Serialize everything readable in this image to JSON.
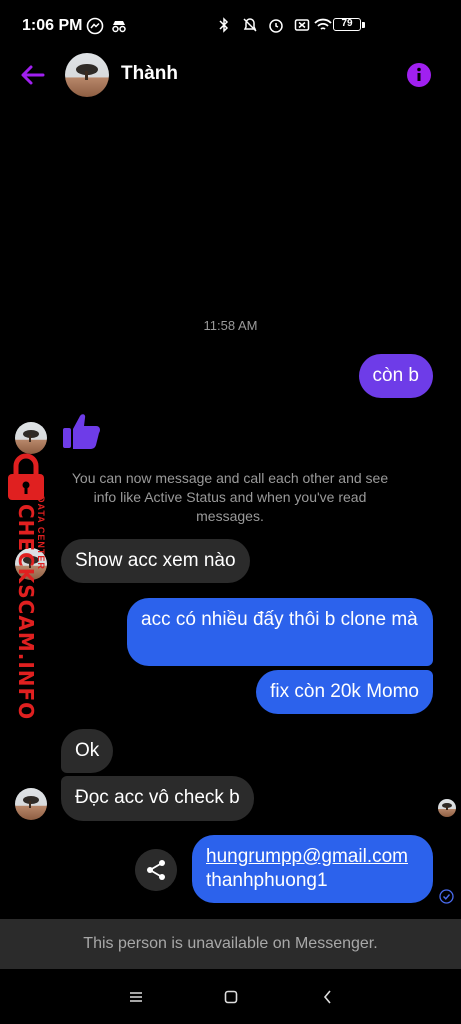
{
  "status_bar": {
    "time": "1:06 PM",
    "battery": "79",
    "left_icons": [
      "messenger-icon",
      "incognito-icon"
    ],
    "right_icons": [
      "bluetooth-icon",
      "bell-off-icon",
      "alarm-icon",
      "sim-off-icon",
      "wifi-icon",
      "battery-icon"
    ]
  },
  "header": {
    "name": "Thành",
    "back_icon": "arrow-left-icon",
    "info_icon": "info-icon"
  },
  "colors": {
    "accent": "#a020f0",
    "sent_purple": "#6e3ce8",
    "sent_blue": "#2c62ec",
    "received": "#2b2b2b",
    "watermark": "#e02020"
  },
  "conversation": {
    "timestamp": "11:58 AM",
    "messages": [
      {
        "from": "me",
        "text": "còn b"
      },
      {
        "from": "them",
        "type": "like-sticker"
      },
      {
        "from": "system",
        "text": "You can now message and call each other and see info like Active Status and when you've read messages."
      },
      {
        "from": "them",
        "text": "Show acc xem nào"
      },
      {
        "from": "me",
        "text": "acc có nhiều đấy thôi b clone mà"
      },
      {
        "from": "me",
        "text": "fix còn 20k Momo"
      },
      {
        "from": "them",
        "text": "Ok"
      },
      {
        "from": "them",
        "text": "Đọc acc vô check b"
      },
      {
        "from": "me",
        "link": "hungrumpp@gmail.com",
        "text": "thanhphuong1"
      }
    ]
  },
  "watermark": {
    "main": "CHECKSCAM.INFO",
    "sub": "DATA CENTER"
  },
  "footer": {
    "unavailable": "This person is unavailable on Messenger."
  },
  "nav": {
    "icons": [
      "menu-icon",
      "home-square-icon",
      "back-chevron-icon"
    ]
  }
}
